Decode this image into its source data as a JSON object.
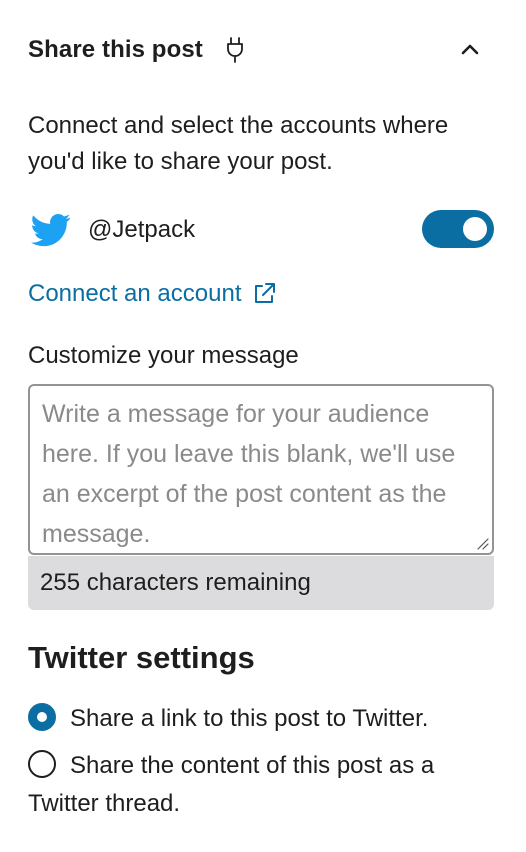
{
  "header": {
    "title": "Share this post"
  },
  "intro": "Connect and select the accounts where you'd like to share your post.",
  "account": {
    "handle": "@Jetpack",
    "enabled": true
  },
  "connect_link": "Connect an account",
  "customize": {
    "label": "Customize your message",
    "placeholder": "Write a message for your audience here. If you leave this blank, we'll use an excerpt of the post content as the message.",
    "counter": "255 characters remaining"
  },
  "twitter_settings": {
    "heading": "Twitter settings",
    "options": [
      {
        "label": "Share a link to this post to Twitter.",
        "checked": true
      },
      {
        "label": "Share the content of this post as a Twitter thread.",
        "checked": false
      }
    ]
  },
  "colors": {
    "accent": "#0b6ea3",
    "twitter": "#1da1f2",
    "counter_bg": "#dcdcde"
  },
  "icons": [
    "plug-icon",
    "chevron-up-icon",
    "twitter-icon",
    "external-link-icon",
    "resize-handle-icon"
  ]
}
